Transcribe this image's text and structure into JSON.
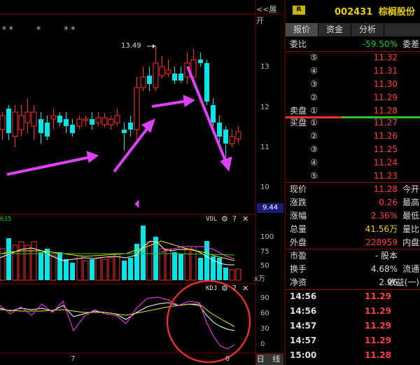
{
  "chart": {
    "expand_label": "<<展开",
    "stars": "**   *   **",
    "high_marker": "13.49",
    "price_axis": [
      "13",
      "12",
      "11",
      "10"
    ],
    "current_price_box": "9.44",
    "vol_title": "VOL",
    "vol_left_value": "635",
    "vol_axis": [
      "100",
      "75",
      "50"
    ],
    "vol_unit": "x万",
    "kdj_title": "KDJ",
    "kdj_axis": [
      "90",
      "60",
      "30",
      "0"
    ],
    "date_labels": [
      "7",
      "8"
    ],
    "timeframe_button": "日 线",
    "colors": {
      "up": "#ff3030",
      "down": "#00e5e5",
      "arrow": "#e040fb",
      "ma_white": "#ffffff",
      "ma_yellow": "#e8e800",
      "ma_green": "#22cc22",
      "ma_magenta": "#ff40ff",
      "highlight_circle": "#e03030"
    }
  },
  "panel": {
    "badge": "R",
    "stock_code": "002431",
    "stock_name": "棕榈股份",
    "tabs": [
      "报价",
      "资金",
      "分析",
      ""
    ],
    "weibi": {
      "label": "委比",
      "value": "-59.50%",
      "right": "委差"
    },
    "sells": [
      {
        "num": "⑤",
        "price": "11.32"
      },
      {
        "num": "④",
        "price": "11.31"
      },
      {
        "num": "③",
        "price": "11.30"
      },
      {
        "num": "②",
        "price": "11.29"
      },
      {
        "label": "卖盘",
        "num": "①",
        "price": "11.28"
      }
    ],
    "buys": [
      {
        "label": "买盘",
        "num": "①",
        "price": "11.27"
      },
      {
        "num": "②",
        "price": "11.26"
      },
      {
        "num": "③",
        "price": "11.25"
      },
      {
        "num": "④",
        "price": "11.24"
      },
      {
        "num": "⑤",
        "price": "11.23"
      }
    ],
    "quote": [
      {
        "l": "现价",
        "v": "11.28",
        "vc": "red",
        "r": "今开"
      },
      {
        "l": "涨跌",
        "v": "0.26",
        "vc": "red",
        "r": "最高"
      },
      {
        "l": "涨幅",
        "v": "2.36%",
        "vc": "red",
        "r": "最低"
      },
      {
        "l": "总量",
        "v": "41.56万",
        "vc": "yellow",
        "r": "量比"
      },
      {
        "l": "外盘",
        "v": "228959",
        "vc": "red",
        "r": "内盘"
      }
    ],
    "fund": [
      {
        "l": "市盈",
        "v": "- 股本",
        "vc": "white",
        "r": ""
      },
      {
        "l": "换手",
        "v": "4.68%",
        "vc": "white",
        "r": "流通"
      },
      {
        "l": "净资",
        "v": "2.96",
        "vc": "white",
        "r": "收益(一)"
      }
    ],
    "ticks": [
      {
        "time": "14:56",
        "price": "11.29"
      },
      {
        "time": "14:56",
        "price": "11.29"
      },
      {
        "time": "14:57",
        "price": "11.29"
      },
      {
        "time": "14:57",
        "price": "11.29"
      },
      {
        "time": "15:00",
        "price": "11.28"
      }
    ]
  }
}
